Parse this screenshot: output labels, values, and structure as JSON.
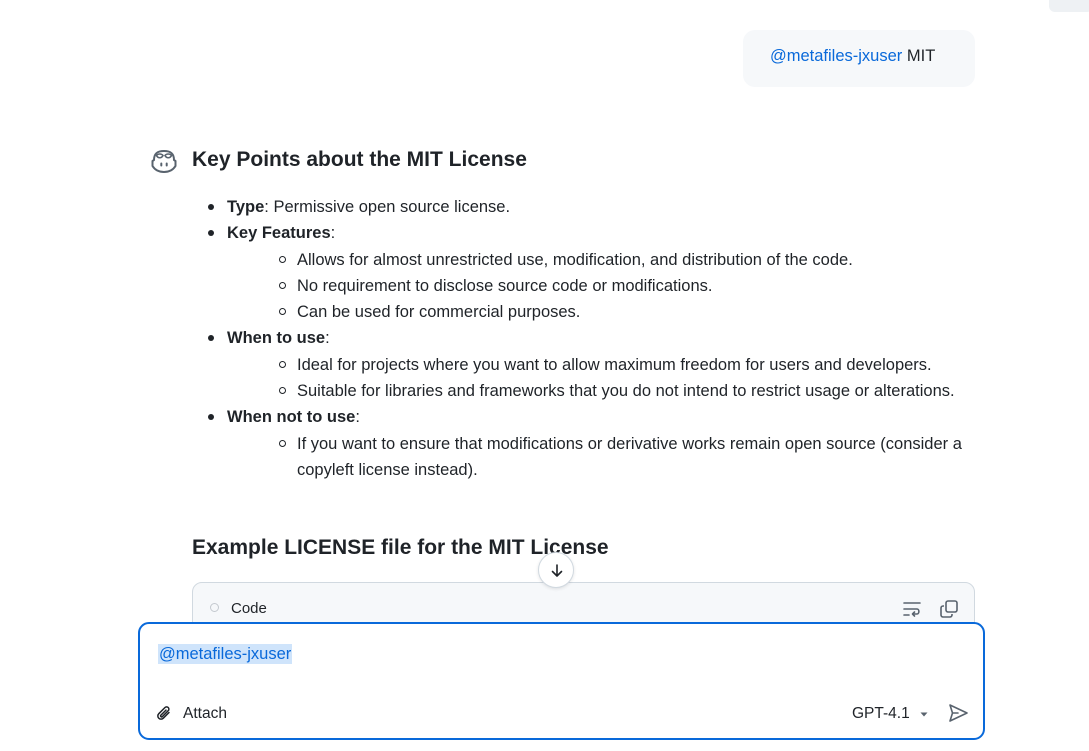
{
  "user_message": {
    "mention": "@metafiles-jxuser",
    "text": " MIT"
  },
  "answer": {
    "heading": "Key Points about the MIT License",
    "items": [
      {
        "label": "Type",
        "text": ": Permissive open source license.",
        "subitems": []
      },
      {
        "label": "Key Features",
        "text": ":",
        "subitems": [
          "Allows for almost unrestricted use, modification, and distribution of the code.",
          "No requirement to disclose source code or modifications.",
          "Can be used for commercial purposes."
        ]
      },
      {
        "label": "When to use",
        "text": ":",
        "subitems": [
          "Ideal for projects where you want to allow maximum freedom for users and developers.",
          "Suitable for libraries and frameworks that you do not intend to restrict usage or alterations."
        ]
      },
      {
        "label": "When not to use",
        "text": ":",
        "subitems": [
          "If you want to ensure that modifications or derivative works remain open source (consider a copyleft license instead)."
        ]
      }
    ],
    "heading2": "Example LICENSE file for the MIT License"
  },
  "code_block": {
    "label": "Code"
  },
  "composer": {
    "mention": "@metafiles-jxuser",
    "attach_label": "Attach",
    "model_label": "GPT-4.1"
  },
  "icons": {
    "assistant": "copilot-icon",
    "scroll": "arrow-down-icon",
    "wrap": "word-wrap-icon",
    "copy": "copy-icon",
    "attach": "paperclip-icon",
    "model": "triangle-down-icon",
    "send": "send-icon"
  },
  "colors": {
    "accent": "#0969da",
    "text": "#1f2328",
    "bubble": "#f6f8fa",
    "selection": "#cfe4fb"
  }
}
